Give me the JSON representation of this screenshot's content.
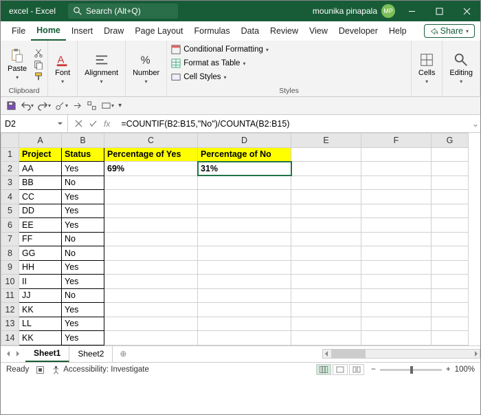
{
  "title": "excel - Excel",
  "search_placeholder": "Search (Alt+Q)",
  "user": {
    "name": "mounika pinapala",
    "initials": "MP"
  },
  "tabs": [
    "File",
    "Home",
    "Insert",
    "Draw",
    "Page Layout",
    "Formulas",
    "Data",
    "Review",
    "View",
    "Developer",
    "Help"
  ],
  "active_tab": "Home",
  "share": "Share",
  "ribbon": {
    "clipboard": {
      "paste": "Paste",
      "label": "Clipboard"
    },
    "font": {
      "btn": "Font"
    },
    "alignment": {
      "btn": "Alignment"
    },
    "number": {
      "btn": "Number"
    },
    "styles": {
      "cond": "Conditional Formatting",
      "fmt": "Format as Table",
      "cell": "Cell Styles",
      "label": "Styles"
    },
    "cells": {
      "btn": "Cells"
    },
    "editing": {
      "btn": "Editing"
    }
  },
  "namebox": "D2",
  "formula": "=COUNTIF(B2:B15,\"No\")/COUNTA(B2:B15)",
  "columns": [
    "A",
    "B",
    "C",
    "D",
    "E",
    "F",
    "G"
  ],
  "rows": [
    "1",
    "2",
    "3",
    "4",
    "5",
    "6",
    "7",
    "8",
    "9",
    "10",
    "11",
    "12",
    "13",
    "14"
  ],
  "headers": {
    "A": "Project",
    "B": "Status",
    "C": "Percentage of Yes",
    "D": "Percentage of No"
  },
  "data": [
    {
      "A": "AA",
      "B": "Yes",
      "C": "69%",
      "D": "31%"
    },
    {
      "A": "BB",
      "B": "No"
    },
    {
      "A": "CC",
      "B": "Yes"
    },
    {
      "A": "DD",
      "B": "Yes"
    },
    {
      "A": "EE",
      "B": "Yes"
    },
    {
      "A": "FF",
      "B": "No"
    },
    {
      "A": "GG",
      "B": "No"
    },
    {
      "A": "HH",
      "B": "Yes"
    },
    {
      "A": "II",
      "B": "Yes"
    },
    {
      "A": "JJ",
      "B": "No"
    },
    {
      "A": "KK",
      "B": "Yes"
    },
    {
      "A": "LL",
      "B": "Yes"
    },
    {
      "A": "KK",
      "B": "Yes"
    }
  ],
  "sheets": [
    "Sheet1",
    "Sheet2"
  ],
  "active_sheet": "Sheet1",
  "status": {
    "ready": "Ready",
    "access": "Accessibility: Investigate",
    "zoom": "100%"
  }
}
